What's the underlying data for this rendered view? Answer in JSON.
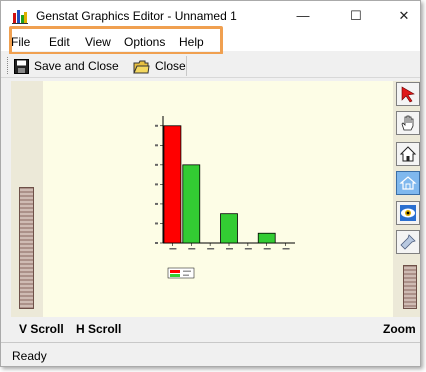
{
  "window": {
    "title": "Genstat Graphics Editor - Unnamed 1",
    "controls": {
      "minimize": "—",
      "maximize": "☐",
      "close": "✕"
    }
  },
  "menubar": {
    "items": [
      "File",
      "Edit",
      "View",
      "Options",
      "Help"
    ],
    "highlight_color": "#f0a050"
  },
  "toolbar": {
    "save_close_label": "Save and Close",
    "close_label": "Close"
  },
  "tools": [
    {
      "icon": "pointer-arrow-icon",
      "active": false
    },
    {
      "icon": "hand-pan-icon",
      "active": false
    },
    {
      "icon": "home-view-icon",
      "active": false
    },
    {
      "icon": "zoom-region-icon",
      "active": true
    },
    {
      "icon": "eye-view-icon",
      "active": false
    },
    {
      "icon": "flashlight-icon",
      "active": false
    }
  ],
  "labels": {
    "v_scroll": "V Scroll",
    "h_scroll": "H Scroll",
    "zoom": "Zoom"
  },
  "status": {
    "text": "Ready"
  },
  "chart_data": {
    "type": "bar",
    "categories": [
      "",
      "",
      "",
      "",
      "",
      "",
      ""
    ],
    "series": [
      {
        "color": "#ff0000",
        "values": [
          12,
          0,
          0,
          0,
          0,
          0,
          0
        ]
      },
      {
        "color": "#33cc33",
        "values": [
          0,
          8,
          0,
          3,
          0,
          1,
          0
        ]
      }
    ],
    "ylim": [
      0,
      13
    ],
    "grid": false,
    "legend_position": "bottom"
  }
}
